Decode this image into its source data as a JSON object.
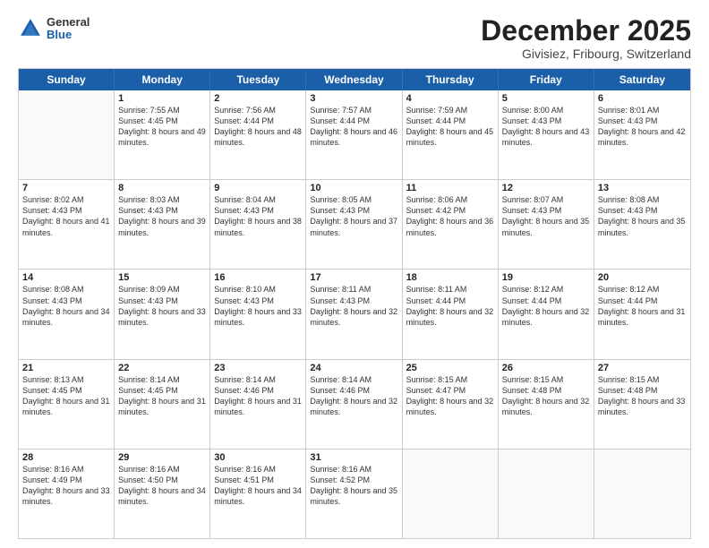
{
  "header": {
    "logo": {
      "general": "General",
      "blue": "Blue"
    },
    "title": "December 2025",
    "location": "Givisiez, Fribourg, Switzerland"
  },
  "calendar": {
    "days_of_week": [
      "Sunday",
      "Monday",
      "Tuesday",
      "Wednesday",
      "Thursday",
      "Friday",
      "Saturday"
    ],
    "weeks": [
      [
        {
          "day": "",
          "sunrise": "",
          "sunset": "",
          "daylight": "",
          "empty": true
        },
        {
          "day": "1",
          "sunrise": "Sunrise: 7:55 AM",
          "sunset": "Sunset: 4:45 PM",
          "daylight": "Daylight: 8 hours and 49 minutes."
        },
        {
          "day": "2",
          "sunrise": "Sunrise: 7:56 AM",
          "sunset": "Sunset: 4:44 PM",
          "daylight": "Daylight: 8 hours and 48 minutes."
        },
        {
          "day": "3",
          "sunrise": "Sunrise: 7:57 AM",
          "sunset": "Sunset: 4:44 PM",
          "daylight": "Daylight: 8 hours and 46 minutes."
        },
        {
          "day": "4",
          "sunrise": "Sunrise: 7:59 AM",
          "sunset": "Sunset: 4:44 PM",
          "daylight": "Daylight: 8 hours and 45 minutes."
        },
        {
          "day": "5",
          "sunrise": "Sunrise: 8:00 AM",
          "sunset": "Sunset: 4:43 PM",
          "daylight": "Daylight: 8 hours and 43 minutes."
        },
        {
          "day": "6",
          "sunrise": "Sunrise: 8:01 AM",
          "sunset": "Sunset: 4:43 PM",
          "daylight": "Daylight: 8 hours and 42 minutes."
        }
      ],
      [
        {
          "day": "7",
          "sunrise": "Sunrise: 8:02 AM",
          "sunset": "Sunset: 4:43 PM",
          "daylight": "Daylight: 8 hours and 41 minutes."
        },
        {
          "day": "8",
          "sunrise": "Sunrise: 8:03 AM",
          "sunset": "Sunset: 4:43 PM",
          "daylight": "Daylight: 8 hours and 39 minutes."
        },
        {
          "day": "9",
          "sunrise": "Sunrise: 8:04 AM",
          "sunset": "Sunset: 4:43 PM",
          "daylight": "Daylight: 8 hours and 38 minutes."
        },
        {
          "day": "10",
          "sunrise": "Sunrise: 8:05 AM",
          "sunset": "Sunset: 4:43 PM",
          "daylight": "Daylight: 8 hours and 37 minutes."
        },
        {
          "day": "11",
          "sunrise": "Sunrise: 8:06 AM",
          "sunset": "Sunset: 4:42 PM",
          "daylight": "Daylight: 8 hours and 36 minutes."
        },
        {
          "day": "12",
          "sunrise": "Sunrise: 8:07 AM",
          "sunset": "Sunset: 4:43 PM",
          "daylight": "Daylight: 8 hours and 35 minutes."
        },
        {
          "day": "13",
          "sunrise": "Sunrise: 8:08 AM",
          "sunset": "Sunset: 4:43 PM",
          "daylight": "Daylight: 8 hours and 35 minutes."
        }
      ],
      [
        {
          "day": "14",
          "sunrise": "Sunrise: 8:08 AM",
          "sunset": "Sunset: 4:43 PM",
          "daylight": "Daylight: 8 hours and 34 minutes."
        },
        {
          "day": "15",
          "sunrise": "Sunrise: 8:09 AM",
          "sunset": "Sunset: 4:43 PM",
          "daylight": "Daylight: 8 hours and 33 minutes."
        },
        {
          "day": "16",
          "sunrise": "Sunrise: 8:10 AM",
          "sunset": "Sunset: 4:43 PM",
          "daylight": "Daylight: 8 hours and 33 minutes."
        },
        {
          "day": "17",
          "sunrise": "Sunrise: 8:11 AM",
          "sunset": "Sunset: 4:43 PM",
          "daylight": "Daylight: 8 hours and 32 minutes."
        },
        {
          "day": "18",
          "sunrise": "Sunrise: 8:11 AM",
          "sunset": "Sunset: 4:44 PM",
          "daylight": "Daylight: 8 hours and 32 minutes."
        },
        {
          "day": "19",
          "sunrise": "Sunrise: 8:12 AM",
          "sunset": "Sunset: 4:44 PM",
          "daylight": "Daylight: 8 hours and 32 minutes."
        },
        {
          "day": "20",
          "sunrise": "Sunrise: 8:12 AM",
          "sunset": "Sunset: 4:44 PM",
          "daylight": "Daylight: 8 hours and 31 minutes."
        }
      ],
      [
        {
          "day": "21",
          "sunrise": "Sunrise: 8:13 AM",
          "sunset": "Sunset: 4:45 PM",
          "daylight": "Daylight: 8 hours and 31 minutes."
        },
        {
          "day": "22",
          "sunrise": "Sunrise: 8:14 AM",
          "sunset": "Sunset: 4:45 PM",
          "daylight": "Daylight: 8 hours and 31 minutes."
        },
        {
          "day": "23",
          "sunrise": "Sunrise: 8:14 AM",
          "sunset": "Sunset: 4:46 PM",
          "daylight": "Daylight: 8 hours and 31 minutes."
        },
        {
          "day": "24",
          "sunrise": "Sunrise: 8:14 AM",
          "sunset": "Sunset: 4:46 PM",
          "daylight": "Daylight: 8 hours and 32 minutes."
        },
        {
          "day": "25",
          "sunrise": "Sunrise: 8:15 AM",
          "sunset": "Sunset: 4:47 PM",
          "daylight": "Daylight: 8 hours and 32 minutes."
        },
        {
          "day": "26",
          "sunrise": "Sunrise: 8:15 AM",
          "sunset": "Sunset: 4:48 PM",
          "daylight": "Daylight: 8 hours and 32 minutes."
        },
        {
          "day": "27",
          "sunrise": "Sunrise: 8:15 AM",
          "sunset": "Sunset: 4:48 PM",
          "daylight": "Daylight: 8 hours and 33 minutes."
        }
      ],
      [
        {
          "day": "28",
          "sunrise": "Sunrise: 8:16 AM",
          "sunset": "Sunset: 4:49 PM",
          "daylight": "Daylight: 8 hours and 33 minutes."
        },
        {
          "day": "29",
          "sunrise": "Sunrise: 8:16 AM",
          "sunset": "Sunset: 4:50 PM",
          "daylight": "Daylight: 8 hours and 34 minutes."
        },
        {
          "day": "30",
          "sunrise": "Sunrise: 8:16 AM",
          "sunset": "Sunset: 4:51 PM",
          "daylight": "Daylight: 8 hours and 34 minutes."
        },
        {
          "day": "31",
          "sunrise": "Sunrise: 8:16 AM",
          "sunset": "Sunset: 4:52 PM",
          "daylight": "Daylight: 8 hours and 35 minutes."
        },
        {
          "day": "",
          "sunrise": "",
          "sunset": "",
          "daylight": "",
          "empty": true
        },
        {
          "day": "",
          "sunrise": "",
          "sunset": "",
          "daylight": "",
          "empty": true
        },
        {
          "day": "",
          "sunrise": "",
          "sunset": "",
          "daylight": "",
          "empty": true
        }
      ]
    ]
  }
}
